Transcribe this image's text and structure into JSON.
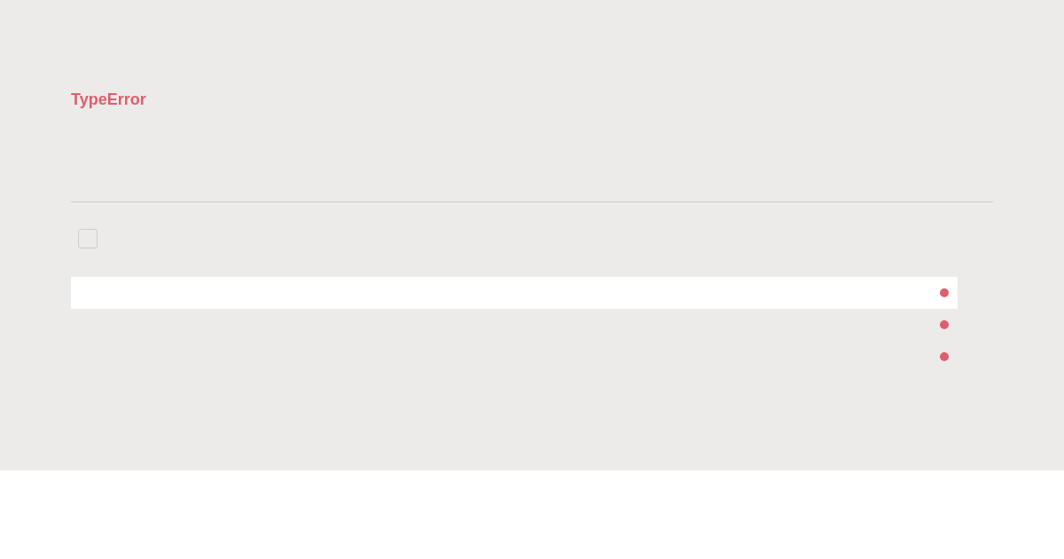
{
  "error": {
    "title": "TypeError"
  },
  "checkbox": {
    "checked": false
  }
}
